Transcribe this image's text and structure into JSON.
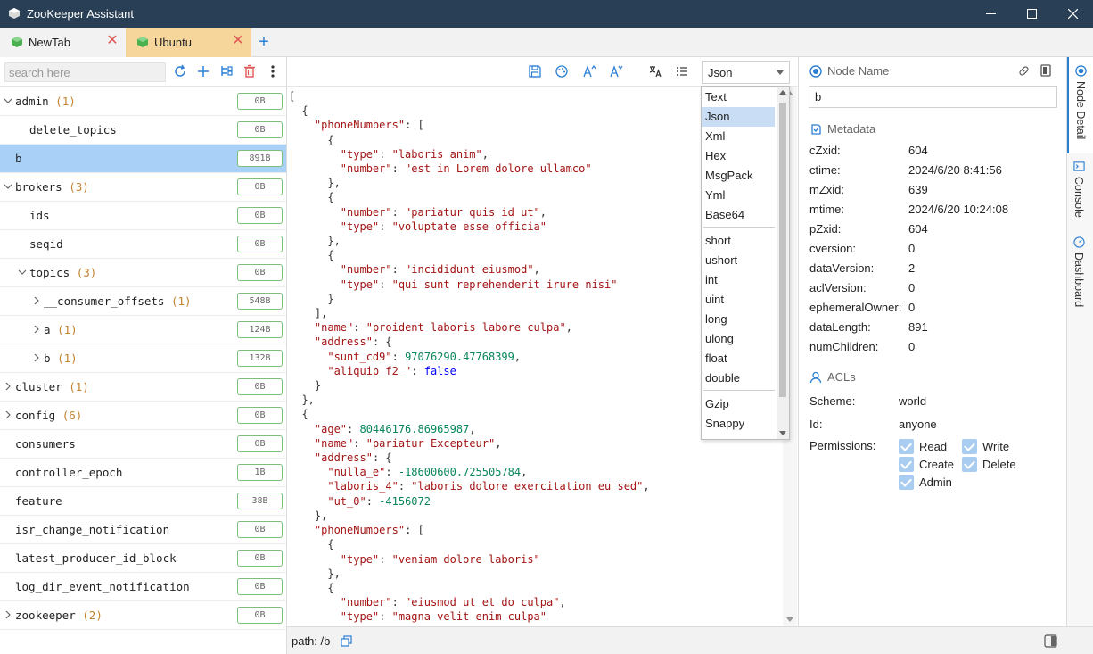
{
  "window": {
    "title": "ZooKeeper Assistant",
    "title_color": "#283f56"
  },
  "tabs": [
    {
      "label": "NewTab"
    },
    {
      "label": "Ubuntu",
      "active": true,
      "color": "#f7d69c"
    }
  ],
  "sidebar": {
    "search_placeholder": "search here",
    "nodes": [
      {
        "name": "admin",
        "count": "(1)",
        "size": "0B",
        "expanded": true
      },
      {
        "name": "delete_topics",
        "count": "",
        "size": "0B"
      },
      {
        "name": "b",
        "count": "",
        "size": "891B",
        "selected": true
      },
      {
        "name": "brokers",
        "count": "(3)",
        "size": "0B",
        "expanded": true
      },
      {
        "name": "ids",
        "count": "",
        "size": "0B"
      },
      {
        "name": "seqid",
        "count": "",
        "size": "0B"
      },
      {
        "name": "topics",
        "count": "(3)",
        "size": "0B",
        "expanded": true
      },
      {
        "name": "__consumer_offsets",
        "count": "(1)",
        "size": "548B"
      },
      {
        "name": "a",
        "count": "(1)",
        "size": "124B"
      },
      {
        "name": "b",
        "count": "(1)",
        "size": "132B"
      },
      {
        "name": "cluster",
        "count": "(1)",
        "size": "0B"
      },
      {
        "name": "config",
        "count": "(6)",
        "size": "0B"
      },
      {
        "name": "consumers",
        "count": "",
        "size": "0B"
      },
      {
        "name": "controller_epoch",
        "count": "",
        "size": "1B"
      },
      {
        "name": "feature",
        "count": "",
        "size": "38B"
      },
      {
        "name": "isr_change_notification",
        "count": "",
        "size": "0B"
      },
      {
        "name": "latest_producer_id_block",
        "count": "",
        "size": "0B"
      },
      {
        "name": "log_dir_event_notification",
        "count": "",
        "size": "0B"
      },
      {
        "name": "zookeeper",
        "count": "(2)",
        "size": "0B"
      }
    ]
  },
  "editor": {
    "format_selected": "Json",
    "format_options": [
      "Text",
      "Json",
      "Xml",
      "Hex",
      "MsgPack",
      "Yml",
      "Base64",
      "short",
      "ushort",
      "int",
      "uint",
      "long",
      "ulong",
      "float",
      "double",
      "Gzip",
      "Snappy"
    ],
    "code_lines": [
      "[",
      "  {",
      "    \"phoneNumbers\": [",
      "      {",
      "        \"type\": \"laboris anim\",",
      "        \"number\": \"est in Lorem dolore ullamco\"",
      "      },",
      "      {",
      "        \"number\": \"pariatur quis id ut\",",
      "        \"type\": \"voluptate esse officia\"",
      "      },",
      "      {",
      "        \"number\": \"incididunt eiusmod\",",
      "        \"type\": \"qui sunt reprehenderit irure nisi\"",
      "      }",
      "    ],",
      "    \"name\": \"proident laboris labore culpa\",",
      "    \"address\": {",
      "      \"sunt_cd9\": 97076290.47768399,",
      "      \"aliquip_f2_\": false",
      "    }",
      "  },",
      "  {",
      "    \"age\": 80446176.86965987,",
      "    \"name\": \"pariatur Excepteur\",",
      "    \"address\": {",
      "      \"nulla_e\": -18600600.725505784,",
      "      \"laboris_4\": \"laboris dolore exercitation eu sed\",",
      "      \"ut_0\": -4156072",
      "    },",
      "    \"phoneNumbers\": [",
      "      {",
      "        \"type\": \"veniam dolore laboris\"",
      "      },",
      "      {",
      "        \"number\": \"eiusmod ut et do culpa\",",
      "        \"type\": \"magna velit enim culpa\"",
      "      }"
    ]
  },
  "status": {
    "path": "path: /b"
  },
  "detail": {
    "node_name_label": "Node Name",
    "node_name_value": "b",
    "metadata_label": "Metadata",
    "metadata": [
      {
        "k": "cZxid:",
        "v": "604"
      },
      {
        "k": "ctime:",
        "v": "2024/6/20 8:41:56"
      },
      {
        "k": "mZxid:",
        "v": "639"
      },
      {
        "k": "mtime:",
        "v": "2024/6/20 10:24:08"
      },
      {
        "k": "pZxid:",
        "v": "604"
      },
      {
        "k": "cversion:",
        "v": "0"
      },
      {
        "k": "dataVersion:",
        "v": "2"
      },
      {
        "k": "aclVersion:",
        "v": "0"
      },
      {
        "k": "ephemeralOwner:",
        "v": "0"
      },
      {
        "k": "dataLength:",
        "v": "891"
      },
      {
        "k": "numChildren:",
        "v": "0"
      }
    ],
    "acls_label": "ACLs",
    "acl_scheme_label": "Scheme:",
    "acl_scheme_value": "world",
    "acl_id_label": "Id:",
    "acl_id_value": "anyone",
    "acl_permissions_label": "Permissions:",
    "permissions": [
      "Read",
      "Write",
      "Create",
      "Delete",
      "Admin"
    ]
  },
  "side_tabs": [
    "Node Detail",
    "Console",
    "Dashboard"
  ]
}
